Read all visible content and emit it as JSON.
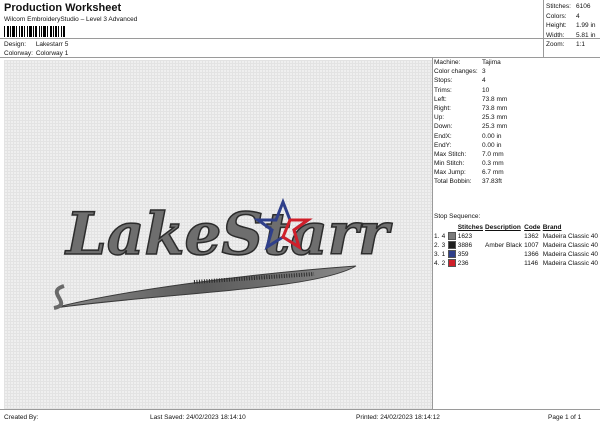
{
  "header": {
    "title": "Production Worksheet",
    "subtitle": "Wilcom EmbroideryStudio – Level 3 Advanced"
  },
  "meta": {
    "design_label": "Design:",
    "design_value": "Lakestarr 5",
    "colorway_label": "Colorway:",
    "colorway_value": "Colorway 1"
  },
  "stats": [
    {
      "k": "Stitches:",
      "v": "6106"
    },
    {
      "k": "Colors:",
      "v": "4"
    },
    {
      "k": "Height:",
      "v": "1.99 in"
    },
    {
      "k": "Width:",
      "v": "5.81 in"
    },
    {
      "k": "Zoom:",
      "v": "1:1"
    }
  ],
  "params": [
    {
      "k": "Machine:",
      "v": "Tajima"
    },
    {
      "k": "Color changes:",
      "v": "3"
    },
    {
      "k": "Stops:",
      "v": "4"
    },
    {
      "k": "Trims:",
      "v": "10"
    },
    {
      "k": "Left:",
      "v": "73.8 mm"
    },
    {
      "k": "Right:",
      "v": "73.8 mm"
    },
    {
      "k": "Up:",
      "v": "25.3 mm"
    },
    {
      "k": "Down:",
      "v": "25.3 mm"
    },
    {
      "k": "EndX:",
      "v": "0.00 in"
    },
    {
      "k": "EndY:",
      "v": "0.00 in"
    },
    {
      "k": "Max Stitch:",
      "v": "7.0 mm"
    },
    {
      "k": "Min Stitch:",
      "v": "0.3 mm"
    },
    {
      "k": "Max Jump:",
      "v": "6.7 mm"
    },
    {
      "k": "Total Bobbin:",
      "v": "37.83ft"
    }
  ],
  "sequence": {
    "title": "Stop Sequence:",
    "headers": {
      "n": "",
      "stop": "",
      "color": "",
      "stitches": "Stitches",
      "desc": "Description",
      "code": "Code",
      "brand": "Brand"
    },
    "rows": [
      {
        "n": "1.",
        "stop": "4",
        "color": "#7b7b7b",
        "stitches": "1623",
        "desc": "",
        "code": "1362",
        "brand": "Madeira Classic 40"
      },
      {
        "n": "2.",
        "stop": "3",
        "color": "#1f1f1f",
        "stitches": "3886",
        "desc": "Amber Black",
        "code": "1007",
        "brand": "Madeira Classic 40"
      },
      {
        "n": "3.",
        "stop": "1",
        "color": "#2f3f8a",
        "stitches": "359",
        "desc": "",
        "code": "1366",
        "brand": "Madeira Classic 40"
      },
      {
        "n": "4.",
        "stop": "2",
        "color": "#d0202a",
        "stitches": "236",
        "desc": "",
        "code": "1146",
        "brand": "Madeira Classic 40"
      }
    ]
  },
  "design_art": {
    "text": "LakeStarr"
  },
  "footer": {
    "created": "Created By:",
    "saved": "Last Saved: 24/02/2023 18:14:10",
    "printed": "Printed: 24/02/2023 18:14:12",
    "page": "Page 1 of 1"
  }
}
